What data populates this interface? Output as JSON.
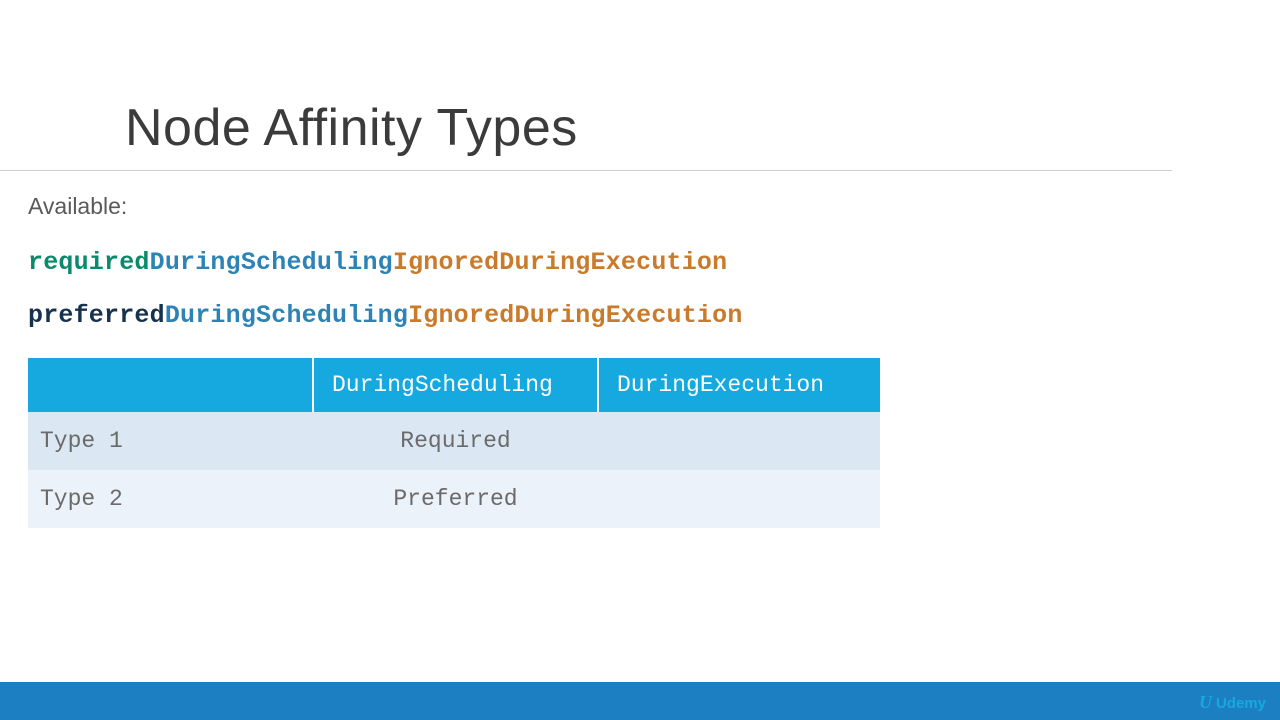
{
  "title": "Node Affinity Types",
  "subtitle": "Available:",
  "lines": [
    {
      "p1": "required",
      "p2": "DuringScheduling",
      "p3": "IgnoredDuringExecution",
      "p1_class": "teal"
    },
    {
      "p1": "preferred",
      "p2": "DuringScheduling",
      "p3": "IgnoredDuringExecution",
      "p1_class": "navy"
    }
  ],
  "table": {
    "headers": [
      "",
      "DuringScheduling",
      "DuringExecution"
    ],
    "rows": [
      {
        "label": "Type 1",
        "scheduling": "Required",
        "execution": ""
      },
      {
        "label": "Type 2",
        "scheduling": "Preferred",
        "execution": ""
      }
    ]
  },
  "brand": "Udemy"
}
